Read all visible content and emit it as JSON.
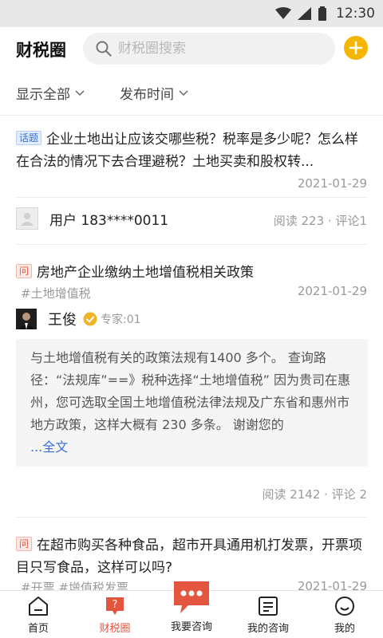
{
  "status": {
    "time": "12:30"
  },
  "header": {
    "title": "财税圈",
    "search_placeholder": "财税圈搜索"
  },
  "filters": {
    "scope": "显示全部",
    "sort": "发布时间"
  },
  "posts": [
    {
      "tag": "话题",
      "title": "企业土地出让应该交哪些税？税率是多少呢？怎么样在合法的情况下去合理避税？土地买卖和股权转...",
      "date": "2021-01-29",
      "user": "用户 183****0011",
      "stats": "阅读 223 · 评论1"
    },
    {
      "tag": "问",
      "title": "房地产企业缴纳土地增值税相关政策",
      "hashtag": "#土地增值税",
      "date": "2021-01-29",
      "expert_name": "王俊",
      "expert_level": "专家:01",
      "answer": "与土地增值税有关的政策法规有1400 多个。 查询路径：“法规库”==》税种选择“土地增值税” 因为贵司在惠州，您可选取全国土地增值税法律法规及广东省和惠州市地方政策，这样大概有 230 多条。 谢谢您的",
      "answer_more_prefix": "...",
      "answer_more": "全文",
      "stats": "阅读 2142 · 评论 2"
    },
    {
      "tag": "问",
      "title": "在超市购买各种食品，超市开具通用机打发票，开票项目只写食品，这样可以吗?",
      "hashtag": "#开票  #增值税发票",
      "date": "2021-01-29"
    }
  ],
  "nav": {
    "home": "首页",
    "circle": "财税圈",
    "consult": "我要咨询",
    "my_consult": "我的咨询",
    "mine": "我的"
  },
  "colors": {
    "accent": "#e2553f",
    "add_button": "#f5b500",
    "link": "#3a6fd8"
  }
}
